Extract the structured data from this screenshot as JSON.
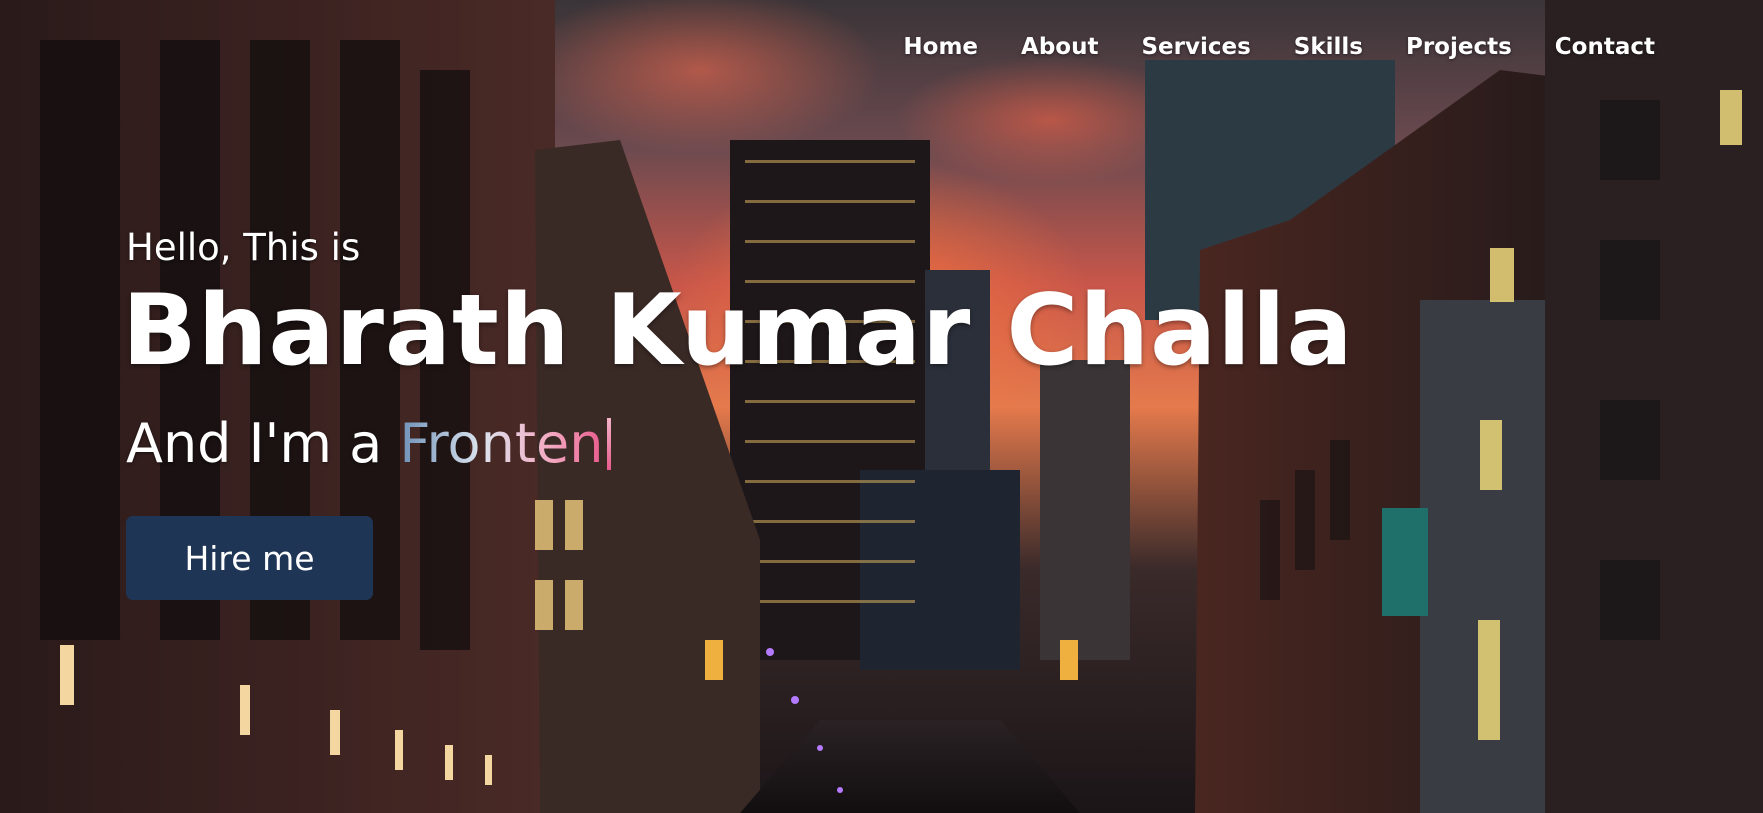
{
  "nav": {
    "items": [
      "Home",
      "About",
      "Services",
      "Skills",
      "Projects",
      "Contact"
    ]
  },
  "hero": {
    "greeting": "Hello, This is",
    "name": "Bharath Kumar Challa",
    "role_prefix": "And I'm a ",
    "role_typed": "Fronten",
    "hire_button": "Hire me"
  },
  "colors": {
    "button_bg": "#1f3556",
    "text": "#ffffff",
    "typed_gradient_start": "#6d8fb8",
    "typed_gradient_end": "#e85b8e"
  },
  "background": "city-street-sunset-photo"
}
